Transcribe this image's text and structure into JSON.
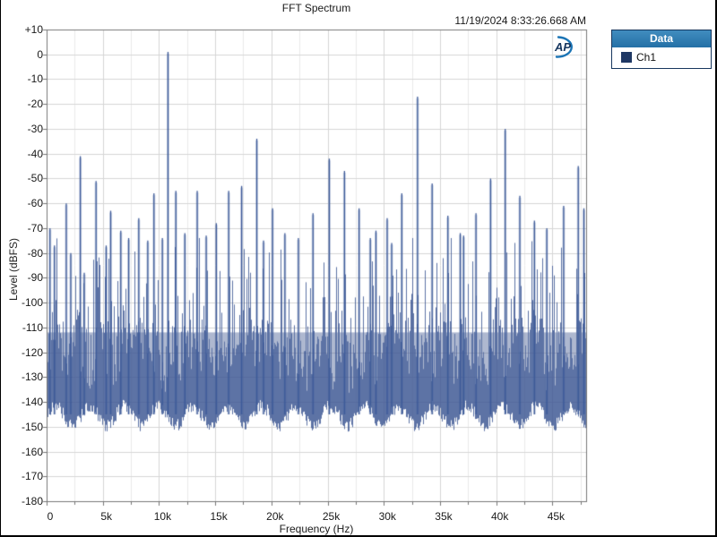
{
  "header": {
    "title": "FFT Spectrum",
    "timestamp": "11/19/2024 8:33:26.668 AM"
  },
  "logo": {
    "text": "AP",
    "text_color": "#16365F",
    "swoosh_color": "#1B74B5"
  },
  "legend": {
    "header": "Data",
    "header_bg": "#2E78AE",
    "border_color": "#17375E",
    "items": [
      {
        "label": "Ch1",
        "color": "#1F3864"
      }
    ]
  },
  "chart_data": {
    "type": "line",
    "title": "FFT Spectrum",
    "xlabel": "Frequency (Hz)",
    "ylabel": "Level (dBFS)",
    "xlim": [
      0,
      48000
    ],
    "ylim": [
      -180,
      10
    ],
    "x_major_tick_step": 5000,
    "x_minor_tick_step": 2500,
    "x_tick_labels": [
      {
        "hz": 0,
        "label": "0"
      },
      {
        "hz": 5000,
        "label": "5k"
      },
      {
        "hz": 10000,
        "label": "10k"
      },
      {
        "hz": 15000,
        "label": "15k"
      },
      {
        "hz": 20000,
        "label": "20k"
      },
      {
        "hz": 25000,
        "label": "25k"
      },
      {
        "hz": 30000,
        "label": "30k"
      },
      {
        "hz": 35000,
        "label": "35k"
      },
      {
        "hz": 40000,
        "label": "40k"
      },
      {
        "hz": 45000,
        "label": "45k"
      }
    ],
    "y_tick_step": 10,
    "y_tick_labels": [
      "+10",
      "0",
      "-10",
      "-20",
      "-30",
      "-40",
      "-50",
      "-60",
      "-70",
      "-80",
      "-90",
      "-100",
      "-110",
      "-120",
      "-130",
      "-140",
      "-150",
      "-160",
      "-170",
      "-180"
    ],
    "grid": {
      "major_color": "#D6D6D6",
      "minor_color": "#EAEAEA",
      "border_color": "#777777"
    },
    "legend_position": "top-right-outside",
    "series": [
      {
        "name": "Ch1",
        "color": "#3D5A99",
        "peaks_hz_db": [
          [
            300,
            -70
          ],
          [
            700,
            -77
          ],
          [
            1750,
            -60
          ],
          [
            2150,
            -80
          ],
          [
            3000,
            -41
          ],
          [
            3350,
            -88
          ],
          [
            4400,
            -51
          ],
          [
            5300,
            -77
          ],
          [
            5700,
            -63
          ],
          [
            6600,
            -71
          ],
          [
            7300,
            -74
          ],
          [
            8200,
            -66
          ],
          [
            9000,
            -75
          ],
          [
            9550,
            -56
          ],
          [
            10300,
            -74
          ],
          [
            10800,
            1
          ],
          [
            11500,
            -55
          ],
          [
            12300,
            -72
          ],
          [
            13400,
            -55
          ],
          [
            14200,
            -73
          ],
          [
            15100,
            -68
          ],
          [
            16200,
            -55
          ],
          [
            17350,
            -53
          ],
          [
            18700,
            -34
          ],
          [
            19300,
            -75
          ],
          [
            20100,
            -62
          ],
          [
            21200,
            -72
          ],
          [
            22400,
            -74
          ],
          [
            23700,
            -64
          ],
          [
            25150,
            -42
          ],
          [
            26500,
            -47
          ],
          [
            27800,
            -62
          ],
          [
            28800,
            -74
          ],
          [
            29300,
            -71
          ],
          [
            30300,
            -66
          ],
          [
            30700,
            -76
          ],
          [
            31600,
            -56
          ],
          [
            33000,
            -17
          ],
          [
            34300,
            -52
          ],
          [
            35700,
            -65
          ],
          [
            36800,
            -72
          ],
          [
            37100,
            -73
          ],
          [
            38200,
            -64
          ],
          [
            39500,
            -50
          ],
          [
            40800,
            -30
          ],
          [
            42100,
            -57
          ],
          [
            43400,
            -67
          ],
          [
            44500,
            -70
          ],
          [
            46000,
            -61
          ],
          [
            47300,
            -45
          ],
          [
            47800,
            -62
          ]
        ],
        "noise_floor": {
          "top_db_mean": -120,
          "top_db_max_spike": -74,
          "bottom_db_range": [
            -152,
            -139
          ],
          "seed": 20241119
        }
      }
    ]
  }
}
